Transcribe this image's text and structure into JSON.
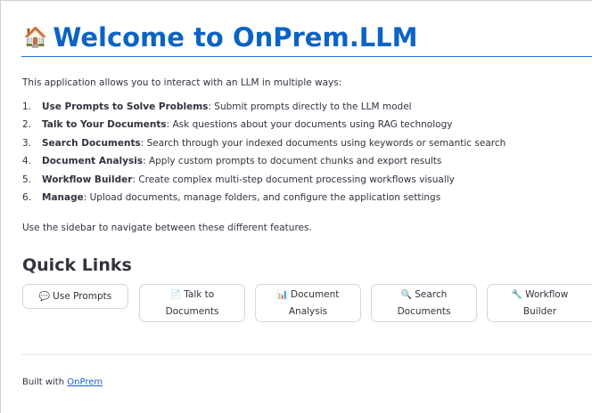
{
  "page": {
    "title": "Welcome to OnPrem.LLM",
    "title_icon": "house-icon"
  },
  "intro": "This application allows you to interact with an LLM in multiple ways:",
  "features": [
    {
      "num": "1.",
      "name": "Use Prompts to Solve Problems",
      "desc": ": Submit prompts directly to the LLM model"
    },
    {
      "num": "2.",
      "name": "Talk to Your Documents",
      "desc": ": Ask questions about your documents using RAG technology"
    },
    {
      "num": "3.",
      "name": "Search Documents",
      "desc": ": Search through your indexed documents using keywords or semantic search"
    },
    {
      "num": "4.",
      "name": "Document Analysis",
      "desc": ": Apply custom prompts to document chunks and export results"
    },
    {
      "num": "5.",
      "name": "Workflow Builder",
      "desc": ": Create complex multi-step document processing workflows visually"
    },
    {
      "num": "6.",
      "name": "Manage",
      "desc": ": Upload documents, manage folders, and configure the application settings"
    }
  ],
  "nav_hint": "Use the sidebar to navigate between these different features.",
  "quick_links": {
    "heading": "Quick Links",
    "buttons": [
      {
        "icon": "💬",
        "icon_name": "speech-bubble-icon",
        "line1": "Use Prompts",
        "line2": ""
      },
      {
        "icon": "📄",
        "icon_name": "document-icon",
        "line1": "Talk to",
        "line2": "Documents"
      },
      {
        "icon": "📊",
        "icon_name": "bar-chart-icon",
        "line1": "Document",
        "line2": "Analysis"
      },
      {
        "icon": "🔍",
        "icon_name": "magnifier-icon",
        "line1": "Search",
        "line2": "Documents"
      },
      {
        "icon": "🔧",
        "icon_name": "wrench-icon",
        "line1": "Workflow",
        "line2": "Builder"
      }
    ]
  },
  "footer": {
    "prefix": "Built with ",
    "link": "OnPrem"
  },
  "colors": {
    "title": "#0b63c5",
    "text": "#31333f",
    "link": "#1a5fd6"
  }
}
